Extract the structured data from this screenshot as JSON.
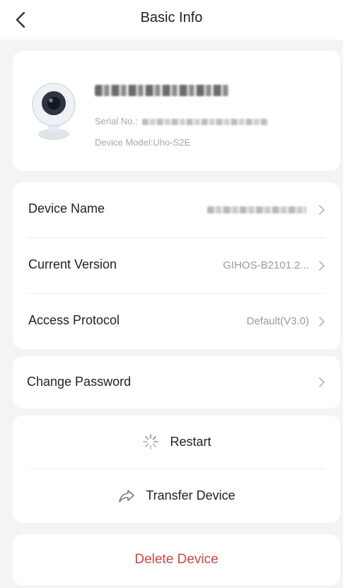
{
  "header": {
    "title": "Basic Info"
  },
  "device": {
    "serial_prefix": "Serial No.:",
    "model": "Device Model:Uho-S2E"
  },
  "rows": [
    {
      "label": "Device Name",
      "value": ""
    },
    {
      "label": "Current Version",
      "value": "GIHOS-B2101.2..."
    },
    {
      "label": "Access Protocol",
      "value": "Default(V3.0)"
    }
  ],
  "password": {
    "label": "Change Password"
  },
  "actions": {
    "restart": "Restart",
    "transfer": "Transfer Device"
  },
  "delete": {
    "label": "Delete Device",
    "color": "#d64545"
  },
  "colors": {
    "background": "#f4f4f6",
    "card": "#ffffff",
    "muted": "#9a9a9a"
  }
}
